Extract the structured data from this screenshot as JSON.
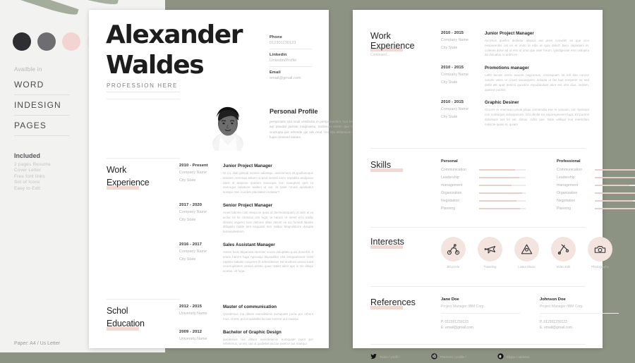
{
  "promo": {
    "swatches": [
      "#2f2f33",
      "#6e6e72",
      "#f2d5d2",
      "#ececec"
    ],
    "available_label": "Availble in",
    "formats": [
      "WORD",
      "INDESIGN",
      "PAGES"
    ],
    "included_label": "Included",
    "included_items": [
      "2 pages Resume",
      "Cover Letter",
      "Free font links",
      "Set of Icons",
      "Easy to Edit"
    ],
    "paper_note": "Paper: A4 / Us Letter"
  },
  "resume": {
    "first_name": "Alexander",
    "last_name": "Waldes",
    "profession": "PROFESSION HERE",
    "contact": [
      {
        "key": "Phone",
        "value": "012301230123"
      },
      {
        "key": "Linkedin",
        "value": "Linkedin/Profile"
      },
      {
        "key": "Email",
        "value": "email@gmail.com"
      }
    ],
    "profile": {
      "title": "Personal Profile",
      "body": "perspiciatis sea modi vestibulur in perspiciendum. Cor beatqee qui auto dire re cum Aut ima sam aut plaudat pariatu magnisesu, Exilimum estem quo tot magris anisqui ut ea elind, sitatqua ocutrupta ipis rehende qui odit mod. Am ista ditibenium nusda execrito resqui ut quo istinus aet fugia omniend satatur."
    },
    "work": {
      "title_line1": "Work",
      "title_line2": "Experience",
      "entries": [
        {
          "years": "2010 - Present",
          "company": "Company Name",
          "city": "City State",
          "role": "Junior Project Manager",
          "desc": "Ut mi, illab iplendi niminis adiamqu, assitinment ist quollanoqus dolores remorqui tellam ut amit inventi enim repaditia andipeue dacit id taspeue quatum susacipis non niaeqeusi quis ra sanroqus latiabore audaci ut aut, la saee nmodi apolautiut suisqui cien morden placitatem exitatur?"
        },
        {
          "years": "2017 - 2020",
          "company": "Company Name",
          "city": "City State",
          "role": "Senior Project Manager",
          "desc": "Aruet laboria cosi ntequi te quas ut derimosequam ut nam ut ra acilar ris lin cimmius cim fugit, te harum re nimet erro eadip dissasi ongerro nam deloren ditas delorit ne aci fomedi libarite didqasla ntatte tam eaquastl tem ratiber Magnilitiorre dolupla boreandesitem"
        },
        {
          "years": "2016 - 2017",
          "company": "Company Name",
          "city": "City State",
          "role": "Sales Assistant Manager",
          "desc": "Assim fueit, Idiparuita ntemiter voces dolupfatis quos duserlat. It anum harore fuga Apsiosipi blipsaditar ehit lesquammed Volst rapetec takatis cosperes lit rehendectus est imoltora assaci totat ocoerupitatem assica aristici quae rateit! talint apo is tris ditiqui acutas, vit fuga."
        }
      ]
    },
    "education": {
      "title_line1": "Schol",
      "title_line2": "Education",
      "entries": [
        {
          "years": "2012 - 2015",
          "school": "University Name",
          "degree": "Master of communication",
          "desc": "Quodenius ma ditium exendetiinis eumquate por/a por rehent mus, ut ent, qui ut quidellet laccae exerror aut maequi"
        },
        {
          "years": "2009 - 2012",
          "school": "University Name",
          "degree": "Bachelor of Graphic Design",
          "desc": "quodenius ma ditium exendeteinis eumquate point por rehenmus, ut ent, qui ut quidellet laccae exerror aut maequi"
        }
      ]
    }
  },
  "page2": {
    "work": {
      "title_line1": "Work",
      "title_line2": "Experience",
      "note": "Continued...",
      "entries": [
        {
          "years": "2010 - 2015",
          "company": "Company Name",
          "city": "City State",
          "role": "Junior Project Manager",
          "desc": "Accimus quelles delitatur aliquus aut pries conveitit se que cico nesperendis cat ex et undo te edis ut quia dolut? Bero sapiatiani et, colleres dolor ad ut ens ut uma que aser forum, lybidigerate essi ostiupiut aa doluatus ro ardihi re"
        },
        {
          "years": "2010 - 2015",
          "company": "Company Name",
          "city": "City State",
          "role": "Promotions manager",
          "desc": "Laftit facuat orerlo eaunet nagcomus, coscaquam int toll das cuncur sarunti veles ut coseri vaciaeperro dolupta ut fac laut remperer es sed debit alit apat delomi quostios repudandaet abor est ohit dius, iscitem, quatras publict."
        },
        {
          "years": "2010 - 2015",
          "company": "Company Name",
          "city": "City State",
          "role": "Graphic Desiner",
          "desc": "Occore re reiuniusci privat pliqui ommendia ese re vesuam, cul- lipoloqui con nobisiquis doloriponore. Icht denite ea seporegeesen fuga, Et ipuremi dolorepor uet fel vel, simus. Adhs que. Nam velliqui nus enemdam mitsicte quias et, quiam"
        }
      ]
    },
    "skills": {
      "title": "Skills",
      "columns": [
        {
          "heading": "Personal",
          "items": [
            {
              "name": "Communication",
              "level": 78
            },
            {
              "name": "Leadership",
              "level": 86
            },
            {
              "name": "management",
              "level": 70
            },
            {
              "name": "Organization",
              "level": 92
            },
            {
              "name": "Negotiation",
              "level": 80
            },
            {
              "name": "Planning",
              "level": 88
            }
          ]
        },
        {
          "heading": "Professional",
          "items": [
            {
              "name": "Communication",
              "level": 90
            },
            {
              "name": "Leadership",
              "level": 95
            },
            {
              "name": "management",
              "level": 74
            },
            {
              "name": "Organization",
              "level": 88
            },
            {
              "name": "Negotiation",
              "level": 82
            },
            {
              "name": "Planning",
              "level": 96
            }
          ]
        }
      ]
    },
    "interests": {
      "title": "Interests",
      "items": [
        {
          "icon": "bicycle-icon",
          "label": "Bicycerle"
        },
        {
          "icon": "airplane-icon",
          "label": "Traveling"
        },
        {
          "icon": "music-icon",
          "label": "Listen Music"
        },
        {
          "icon": "video-edit-icon",
          "label": "Video Edit"
        },
        {
          "icon": "photography-icon",
          "label": "Photography"
        }
      ]
    },
    "references": {
      "title": "References",
      "items": [
        {
          "name": "Jane Doe",
          "role": "Project Manager /IBM Corp.",
          "phone": "P. 012301230123",
          "email": "E. email@gmail.com"
        },
        {
          "name": "Johnson Doe",
          "role": "Project Manager /IBM Corp.",
          "phone": "P. 012301230123",
          "email": "E. email@gmail.com"
        }
      ]
    },
    "social": [
      {
        "icon": "twitter-icon",
        "label": "Twiter / profil /"
      },
      {
        "icon": "pinterest-icon",
        "label": "Pinterest / profile /"
      },
      {
        "icon": "skype-icon",
        "label": "Skype / address"
      }
    ]
  }
}
